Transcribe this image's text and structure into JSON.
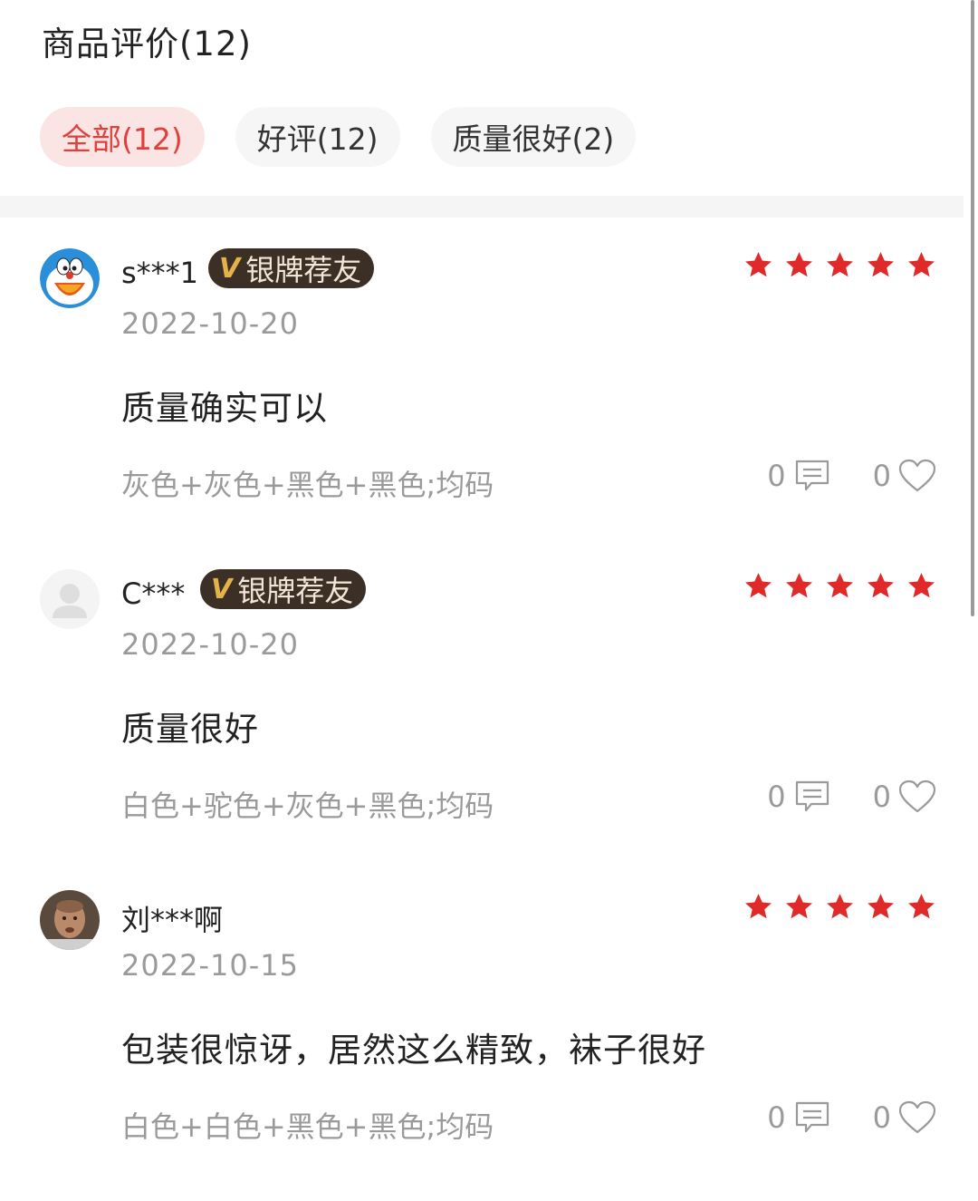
{
  "header": {
    "title": "商品评价(12)"
  },
  "filters": [
    {
      "label": "全部(12)",
      "active": true
    },
    {
      "label": "好评(12)",
      "active": false
    },
    {
      "label": "质量很好(2)",
      "active": false
    }
  ],
  "colors": {
    "accent": "#e0403c",
    "star": "#e02a2a",
    "badge_bg": "#3b2f26",
    "badge_v": "#e3b24a"
  },
  "reviews": [
    {
      "username": "s***1",
      "badge": "银牌荐友",
      "badge_mark": "V",
      "rating": 5,
      "date": "2022-10-20",
      "content": "质量确实可以",
      "spec": "灰色+灰色+黑色+黑色;均码",
      "comment_count": "0",
      "like_count": "0",
      "avatar_icon": "cartoon-avatar-icon"
    },
    {
      "username": "C***",
      "badge": "银牌荐友",
      "badge_mark": "V",
      "rating": 5,
      "date": "2022-10-20",
      "content": "质量很好",
      "spec": "白色+驼色+灰色+黑色;均码",
      "comment_count": "0",
      "like_count": "0",
      "avatar_icon": "default-user-icon"
    },
    {
      "username": "刘***啊",
      "rating": 5,
      "date": "2022-10-15",
      "content": "包装很惊讶，居然这么精致，袜子很好",
      "spec": "白色+白色+黑色+黑色;均码",
      "comment_count": "0",
      "like_count": "0",
      "avatar_icon": "photo-avatar-icon"
    }
  ]
}
